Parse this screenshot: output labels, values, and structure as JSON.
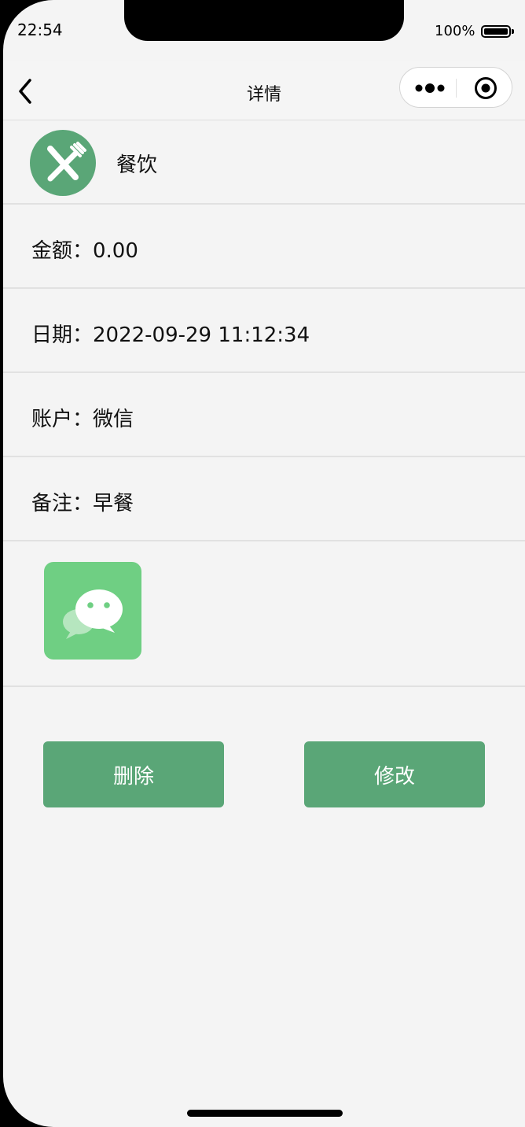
{
  "status_bar": {
    "time": "22:54",
    "battery": "100%"
  },
  "navbar": {
    "title": "详情",
    "back_icon": "chevron-left-icon",
    "more_icon": "more-dots-icon",
    "target_icon": "target-icon"
  },
  "category": {
    "label": "餐饮",
    "icon": "utensils-icon",
    "color": "#5aa677"
  },
  "details": {
    "amount": "金额：0.00",
    "date": "日期：2022-09-29 11:12:34",
    "account": "账户：微信",
    "note": "备注：早餐"
  },
  "attachment": {
    "icon": "wechat-icon",
    "color": "#6fcf83"
  },
  "actions": {
    "delete_label": "删除",
    "edit_label": "修改"
  },
  "colors": {
    "accent": "#5aa677",
    "background": "#f4f4f4"
  }
}
